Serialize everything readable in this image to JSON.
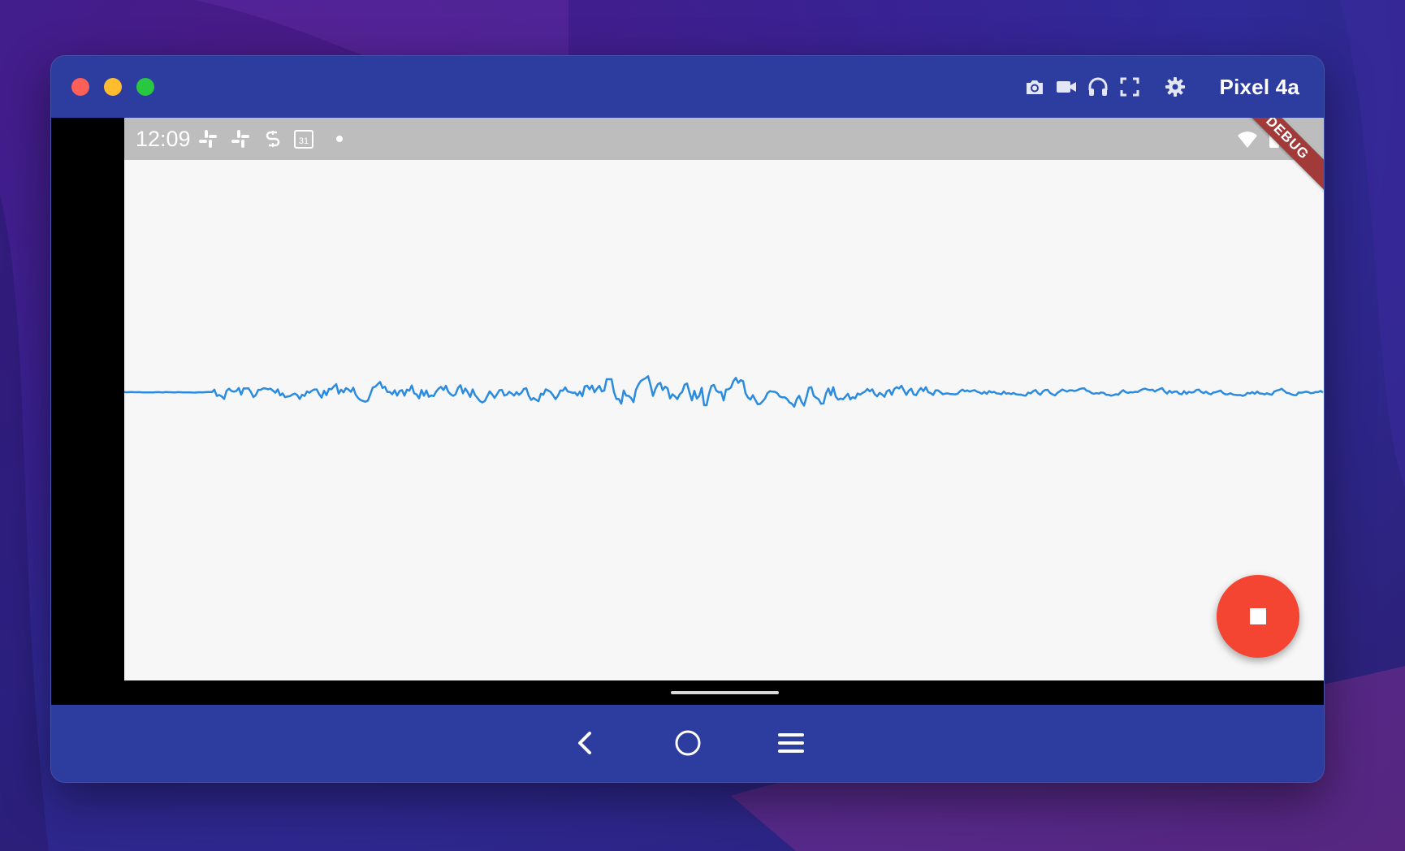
{
  "window": {
    "device_label": "Pixel 4a",
    "controls": {
      "close": "close-button",
      "minimize": "minimize-button",
      "maximize": "maximize-button"
    },
    "toolbar_icons": [
      "camera-icon",
      "video-icon",
      "headphones-icon",
      "fullscreen-icon",
      "gear-icon"
    ]
  },
  "device": {
    "status_bar": {
      "time": "12:09",
      "left_icons": [
        "slack-icon",
        "slack-icon",
        "sync-icon",
        "calendar-icon",
        "dot-icon"
      ],
      "calendar_number": "31",
      "right_icons": [
        "wifi-icon",
        "battery-icon"
      ]
    },
    "debug_banner": "DEBUG",
    "waveform": {
      "color": "#2a8be0"
    },
    "fab": {
      "color": "#f44532",
      "icon": "stop-icon"
    }
  },
  "nav_bar": {
    "buttons": [
      "back-icon",
      "home-icon",
      "menu-icon"
    ]
  },
  "colors": {
    "window_chrome": "#2d3c9f",
    "status_bar": "#bdbdbd",
    "screen_background": "#f7f7f7"
  }
}
